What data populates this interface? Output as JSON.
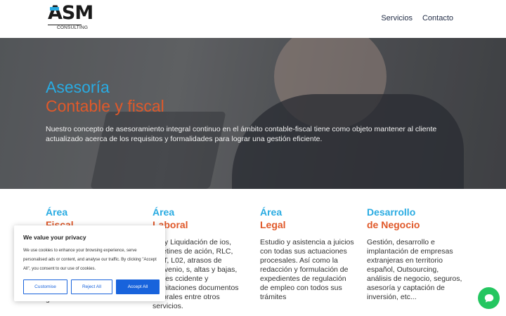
{
  "header": {
    "logo_main": "ASM",
    "logo_sub": "CONSULTING",
    "nav": [
      "Servicios",
      "Contacto"
    ]
  },
  "hero": {
    "title_line1": "Asesoría",
    "title_line2": "Contable y fiscal",
    "text": "Nuestro concepto de asesoramiento integral continuo en el ámbito contable-fiscal tiene como objeto mantener al cliente actualizado acerca de los requisitos y formalidades para lograr una gestión eficiente."
  },
  "services": [
    {
      "t1": "Área",
      "t2": "Fiscal",
      "body": "formalidades para una gestión eficiente."
    },
    {
      "t1": "Área",
      "t2": "Laboral",
      "body": "ulo y Liquidación de ios, boletines de ación, RLC, RNT, L02, atrasos de convenio, s, altas y bajas, partes ccidente y tramitaciones documentos laborales entre otros servicios."
    },
    {
      "t1": "Área",
      "t2": "Legal",
      "body": "Estudio y asistencia a juicios con todas sus actuaciones procesales. Así como la redacción y formulación de expedientes de regulación de empleo con todos sus trámites"
    },
    {
      "t1": "Desarrollo",
      "t2": "de Negocio",
      "body": "Gestión, desarrollo e implantación de empresas extranjeras en territorio español, Outsourcing, análisis de negocio, seguros, asesoría y captación de inversión, etc..."
    }
  ],
  "cookie": {
    "title": "We value your privacy",
    "body": "We use cookies to enhance your browsing experience, serve personalised ads or content, and analyse our traffic. By clicking \"Accept All\", you consent to our use of cookies.",
    "customise": "Customise",
    "reject": "Reject All",
    "accept": "Accept All"
  },
  "colors": {
    "accent_blue": "#29abe2",
    "accent_orange": "#e0592a",
    "cookie_blue": "#1863dc",
    "chat_green": "#24c660"
  },
  "icons": {
    "chat": "chat-bubble-icon"
  }
}
